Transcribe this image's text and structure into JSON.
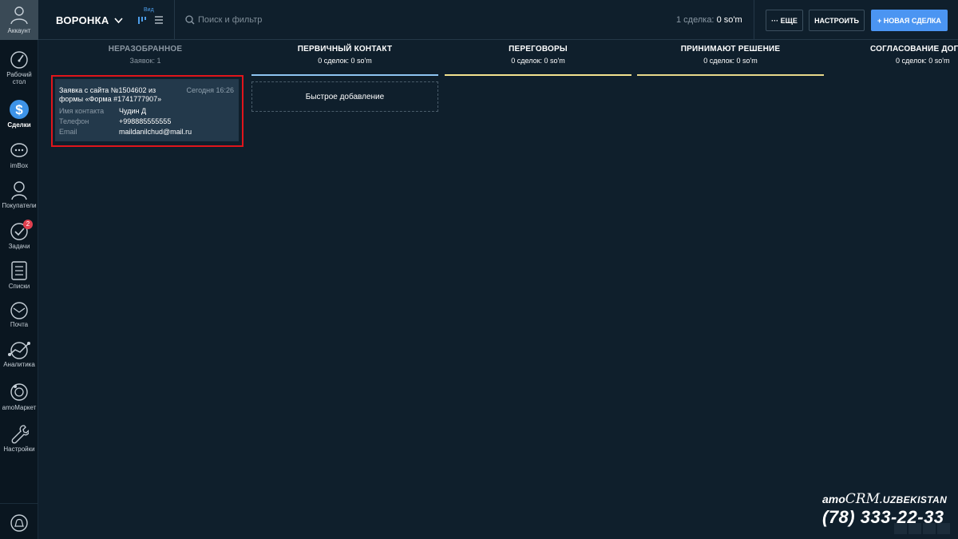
{
  "sidebar": {
    "account_label": "Аккаунт",
    "items": [
      {
        "label": "Рабочий стол",
        "icon": "dashboard-icon"
      },
      {
        "label": "Сделки",
        "icon": "deals-icon",
        "active": true
      },
      {
        "label": "imBox",
        "icon": "chat-icon"
      },
      {
        "label": "Покупатели",
        "icon": "customers-icon"
      },
      {
        "label": "Задачи",
        "icon": "tasks-icon",
        "badge": "2"
      },
      {
        "label": "Списки",
        "icon": "lists-icon"
      },
      {
        "label": "Почта",
        "icon": "mail-icon"
      },
      {
        "label": "Аналитика",
        "icon": "analytics-icon"
      },
      {
        "label": "amoМаркет",
        "icon": "market-icon"
      },
      {
        "label": "Настройки",
        "icon": "settings-icon"
      }
    ]
  },
  "header": {
    "funnel_label": "ВОРОНКА",
    "view_label": "Вид",
    "search_placeholder": "Поиск и фильтр",
    "summary_count": "1 сделка:",
    "summary_amount": "0 so'm",
    "more_label": "··· ЕЩЕ",
    "setup_label": "НАСТРОИТЬ",
    "new_deal_label": "+ НОВАЯ СДЕЛКА"
  },
  "columns": [
    {
      "title": "НЕРАЗОБРАННОЕ",
      "sub": "Заявок: 1"
    },
    {
      "title": "ПЕРВИЧНЫЙ КОНТАКТ",
      "sub": "0 сделок: 0 so'm",
      "color": "#8ec5f2"
    },
    {
      "title": "ПЕРЕГОВОРЫ",
      "sub": "0 сделок: 0 so'm",
      "color": "#f2e28e"
    },
    {
      "title": "ПРИНИМАЮТ РЕШЕНИЕ",
      "sub": "0 сделок: 0 so'm",
      "color": "#e8d88a"
    },
    {
      "title": "СОГЛАСОВАНИЕ ДОГО",
      "sub": "0 сделок: 0 so'm",
      "color": "#d7dbe0"
    }
  ],
  "card": {
    "title": "Заявка с сайта №1504602 из формы «Форма #1741777907»",
    "time": "Сегодня 16:26",
    "fields": [
      {
        "key": "Имя контакта",
        "value": "Чудин Д"
      },
      {
        "key": "Телефон",
        "value": "+998885555555"
      },
      {
        "key": "Email",
        "value": "maildanilchud@mail.ru"
      }
    ]
  },
  "quick_add_label": "Быстрое добавление",
  "brand": {
    "amo": "amo",
    "crm": "CRM",
    "suffix": ".UZBEKISTAN",
    "phone": "(78) 333-22-33"
  },
  "colors": {
    "background": "#0f1f2c",
    "accent": "#4b95f2",
    "highlight": "#e0151b",
    "card_bg": "#23394b"
  }
}
